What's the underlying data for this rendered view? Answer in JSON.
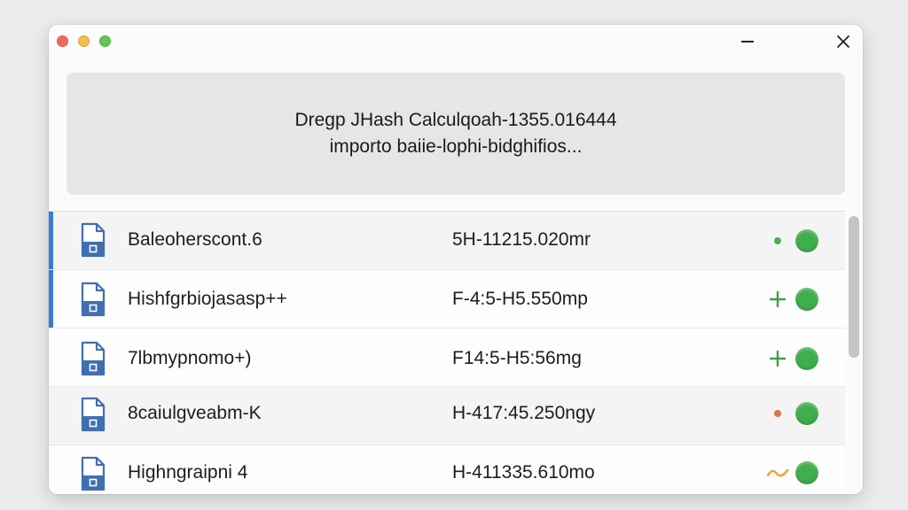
{
  "window": {
    "banner": {
      "line1": "Dregp JHash Calculqoah-1355.016444",
      "line2": "importo baiie-lophi-bidghifios..."
    }
  },
  "rows": [
    {
      "name": "Baleoherscont.6",
      "value": "5H-11215.020mr",
      "mark": "dot",
      "mark_color": "#4caf50",
      "selected": true
    },
    {
      "name": "Hishfgrbiojasasp++",
      "value": "F-4:5-H5.550mp",
      "mark": "plus",
      "mark_color": "#43a047",
      "selected": true
    },
    {
      "name": "7lbmypnomo+)",
      "value": "F14:5-H5:56mg",
      "mark": "plus",
      "mark_color": "#43a047",
      "selected": false
    },
    {
      "name": "8caiulgveabm-K",
      "value": "H-417:45.250ngy",
      "mark": "dot",
      "mark_color": "#e0734a",
      "selected": false
    },
    {
      "name": "Highngraipni 4",
      "value": "H-411335.610mo",
      "mark": "wave",
      "mark_color": "#f0a030",
      "selected": false
    }
  ],
  "colors": {
    "accent": "#3a7bd5",
    "status_ok": "#3fae4c",
    "file_icon": "#3f6fb0"
  },
  "icons": {
    "file": "document-icon",
    "status": "status-dot-icon"
  }
}
